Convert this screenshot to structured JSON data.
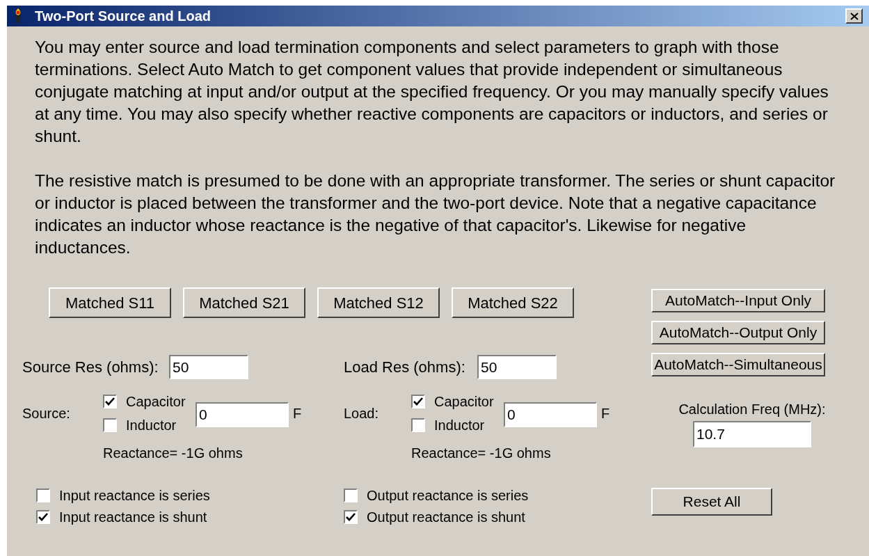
{
  "window": {
    "title": "Two-Port Source and Load"
  },
  "description": [
    "You may enter source and load termination components and select parameters to graph with those terminations. Select Auto Match to get component values that provide independent or simultaneous conjugate matching at input and/or output at the specified frequency. Or you may manually specify values at any time. You may also specify whether reactive components are capacitors or inductors, and series or shunt.",
    "The resistive match is presumed to be done with an appropriate transformer. The series or shunt capacitor or inductor is placed between the transformer and the two-port device. Note that a negative capacitance indicates an inductor whose reactance is the negative of that capacitor's. Likewise for negative inductances."
  ],
  "matched_buttons": [
    "Matched S11",
    "Matched S21",
    "Matched S12",
    "Matched S22"
  ],
  "automatch_buttons": [
    "AutoMatch--Input Only",
    "AutoMatch--Output Only",
    "AutoMatch--Simultaneous"
  ],
  "ports": [
    {
      "res_label": "Source Res (ohms):",
      "res_value": "50",
      "label": "Source:",
      "options": [
        {
          "label": "Capacitor",
          "checked": true
        },
        {
          "label": "Inductor",
          "checked": false
        }
      ],
      "value": "0",
      "unit": "F",
      "reactance": "Reactance= -1G ohms",
      "placement": [
        {
          "label": "Input reactance is series",
          "checked": false
        },
        {
          "label": "Input reactance is shunt",
          "checked": true
        }
      ]
    },
    {
      "res_label": "Load Res (ohms):",
      "res_value": "50",
      "label": "Load:",
      "options": [
        {
          "label": "Capacitor",
          "checked": true
        },
        {
          "label": "Inductor",
          "checked": false
        }
      ],
      "value": "0",
      "unit": "F",
      "reactance": "Reactance= -1G ohms",
      "placement": [
        {
          "label": "Output reactance is series",
          "checked": false
        },
        {
          "label": "Output reactance is shunt",
          "checked": true
        }
      ]
    }
  ],
  "calculation": {
    "label": "Calculation Freq (MHz):",
    "value": "10.7"
  },
  "reset_button": "Reset All"
}
